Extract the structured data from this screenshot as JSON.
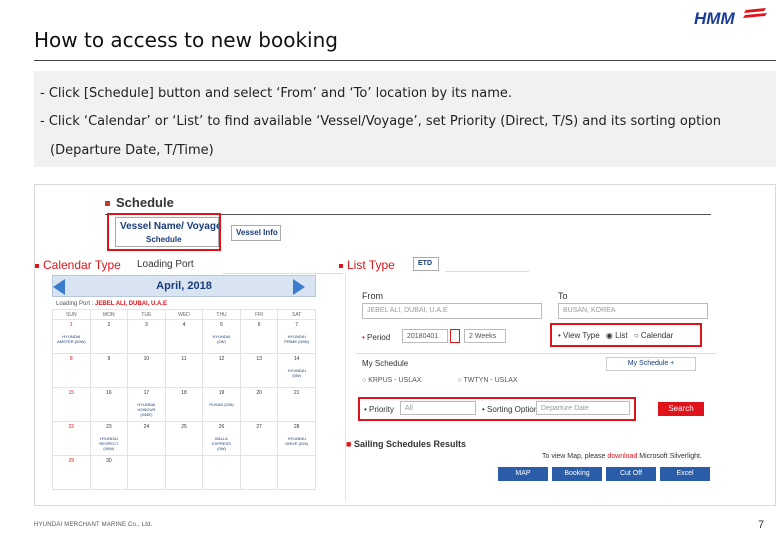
{
  "slide": {
    "title": "How to access to new booking",
    "logo_text": "HMM",
    "footer": "HYUNDAI MERCHANT MARINE Co., Ltd.",
    "page_number": "7",
    "instructions": [
      "- Click [Schedule] button and select ‘From’ and ‘To’ location by its name.",
      "- Click ‘Calendar’ or ‘List’ to find available ‘Vessel/Voyage’, set Priority (Direct, T/S) and its sorting option",
      "(Departure Date, T/Time)"
    ]
  },
  "screenshot": {
    "section_title": "Schedule",
    "tabs": {
      "vessel_name_voyage": "Vessel Name/ Voyage",
      "schedule": "Schedule",
      "vessel_info": "Vessel Info"
    },
    "calendar_type_label": "Calendar Type",
    "list_type_label": "List Type",
    "loading_port_label": "Loading Port",
    "etd_label": "ETD",
    "calendar": {
      "month": "April, 2018",
      "loading_port_prefix": "Loading Port :",
      "loading_port_value": "JEBEL ALI, DUBAI, U.A.E",
      "weekdays": [
        "SUN",
        "MON",
        "TUE",
        "WED",
        "THU",
        "FRI",
        "SAT"
      ],
      "weeks": [
        [
          {
            "d": "1",
            "ev": "HYUNDAI\nAMSTER (00W)",
            "red": true
          },
          {
            "d": "2",
            "ev": ""
          },
          {
            "d": "3",
            "ev": ""
          },
          {
            "d": "4",
            "ev": ""
          },
          {
            "d": "5",
            "ev": "HYUNDAI\n(0W)"
          },
          {
            "d": "6",
            "ev": ""
          },
          {
            "d": "7",
            "ev": "HYUNDAI\nPRIME (00W)"
          }
        ],
        [
          {
            "d": "8",
            "ev": "",
            "red": true
          },
          {
            "d": "9",
            "ev": ""
          },
          {
            "d": "10",
            "ev": ""
          },
          {
            "d": "11",
            "ev": ""
          },
          {
            "d": "12",
            "ev": ""
          },
          {
            "d": "13",
            "ev": ""
          },
          {
            "d": "14",
            "ev": "HYUNDAI\n(0W)"
          }
        ],
        [
          {
            "d": "15",
            "ev": "",
            "red": true
          },
          {
            "d": "16",
            "ev": ""
          },
          {
            "d": "17",
            "ev": "HYUNDAI\nHONOUR\n(044E)"
          },
          {
            "d": "18",
            "ev": ""
          },
          {
            "d": "19",
            "ev": "PUSAN (026)"
          },
          {
            "d": "20",
            "ev": ""
          },
          {
            "d": "21",
            "ev": ""
          }
        ],
        [
          {
            "d": "22",
            "ev": "",
            "red": true
          },
          {
            "d": "23",
            "ev": "HYUNDAI\nRESPECT\n(00W)"
          },
          {
            "d": "24",
            "ev": ""
          },
          {
            "d": "25",
            "ev": ""
          },
          {
            "d": "26",
            "ev": "BALLA\nEXPRESS\n(0W)"
          },
          {
            "d": "27",
            "ev": ""
          },
          {
            "d": "28",
            "ev": "HYUNDAI\nDRIVE (026)"
          }
        ],
        [
          {
            "d": "29",
            "ev": "",
            "red": true
          },
          {
            "d": "30",
            "ev": ""
          },
          {
            "d": "",
            "ev": ""
          },
          {
            "d": "",
            "ev": ""
          },
          {
            "d": "",
            "ev": ""
          },
          {
            "d": "",
            "ev": ""
          },
          {
            "d": "",
            "ev": ""
          }
        ]
      ]
    },
    "list": {
      "from_label": "From",
      "to_label": "To",
      "from_value": "JEBEL ALI, DUBAI, U.A.E",
      "to_value": "BUSAN, KOREA",
      "period_label": "Period",
      "period_date": "20180401",
      "period_weeks": "2 Weeks",
      "view_type_label": "View Type",
      "view_list": "List",
      "view_calendar": "Calendar",
      "my_schedule_label": "My Schedule",
      "my_schedule_button": "My Schedule +",
      "my_schedule_options": [
        "KRPUS - USLAX",
        "TWTYN - USLAX"
      ],
      "priority_label": "Priority",
      "priority_value": "All",
      "sorting_label": "Sorting Option",
      "sorting_value": "Departure Date",
      "search_button": "Search",
      "results_title": "Sailing Schedules Results",
      "map_note_prefix": "To view Map, please",
      "map_note_link": "download",
      "map_note_suffix": "Microsoft Silverlight.",
      "buttons": [
        "MAP",
        "Booking",
        "Cut Off",
        "Excel"
      ]
    }
  },
  "colors": {
    "highlight_red": "#e0121a",
    "brand_blue": "#1a3b7a",
    "button_blue": "#2a5ca8",
    "instruction_bg": "#f1f1f1"
  }
}
